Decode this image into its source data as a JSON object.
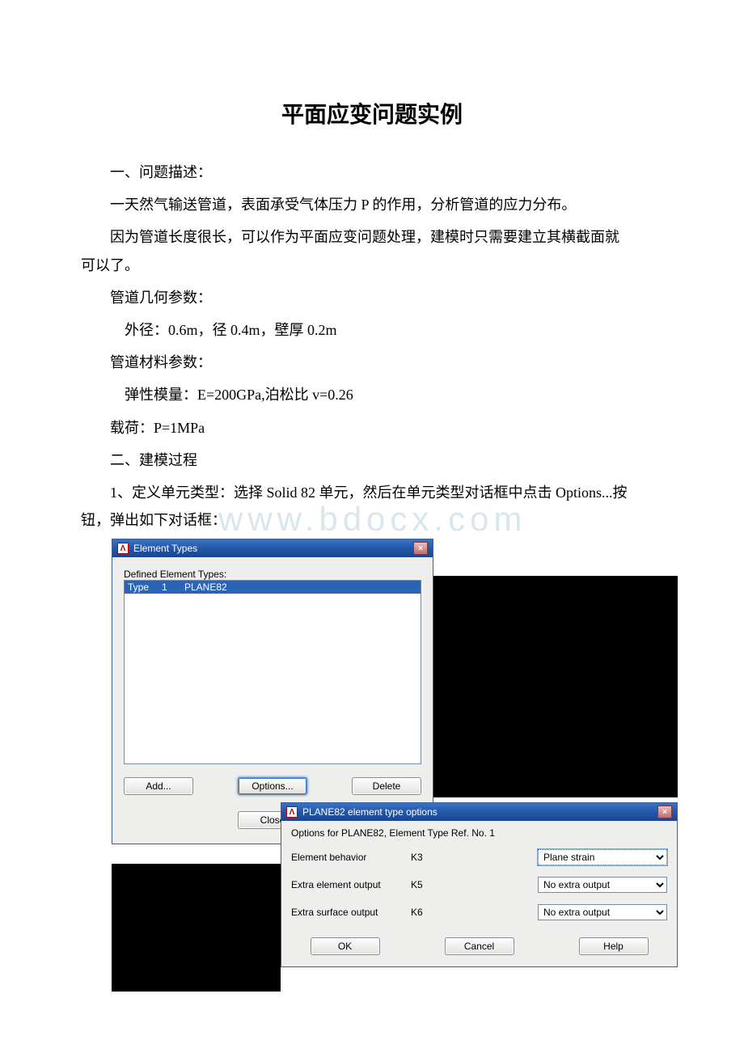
{
  "doc": {
    "title": "平面应变问题实例",
    "p1": "一、问题描述：",
    "p2": "一天然气输送管道，表面承受气体压力 P 的作用，分析管道的应力分布。",
    "p3": "因为管道长度很长，可以作为平面应变问题处理，建模时只需要建立其横截面就可以了。",
    "p3_a": "因为管道长度很长，可以作为平面应变问题处理，建模时只需要建立其横截面就",
    "p3_b": "可以了。",
    "p4": "管道几何参数：",
    "p5": "外径：0.6m，径 0.4m，壁厚 0.2m",
    "p6": "管道材料参数：",
    "p7": "弹性模量：E=200GPa,泊松比 v=0.26",
    "p8": "载荷：P=1MPa",
    "p9": "二、建模过程",
    "p10_a": "1、定义单元类型：选择 Solid 82 单元，然后在单元类型对话框中点击 Options...按",
    "p10_b": "钮，弹出如下对话框：",
    "watermark": "www.bdocx.com"
  },
  "et_dialog": {
    "title": "Element Types",
    "icon_glyph": "Λ",
    "defined_label": "Defined Element Types:",
    "selected_type": "Type",
    "selected_num": "1",
    "selected_name": "PLANE82",
    "btn_add": "Add...",
    "btn_options": "Options...",
    "btn_delete": "Delete",
    "btn_close": "Close",
    "close_x": "×"
  },
  "opt_dialog": {
    "title": "PLANE82 element type options",
    "icon_glyph": "Λ",
    "desc": "Options for PLANE82, Element Type Ref. No. 1",
    "rows": [
      {
        "label": "Element behavior",
        "k": "K3",
        "value": "Plane strain",
        "hot": true
      },
      {
        "label": "Extra element output",
        "k": "K5",
        "value": "No extra output",
        "hot": false
      },
      {
        "label": "Extra surface output",
        "k": "K6",
        "value": "No extra output",
        "hot": false
      }
    ],
    "btn_ok": "OK",
    "btn_cancel": "Cancel",
    "btn_help": "Help",
    "close_x": "×"
  }
}
